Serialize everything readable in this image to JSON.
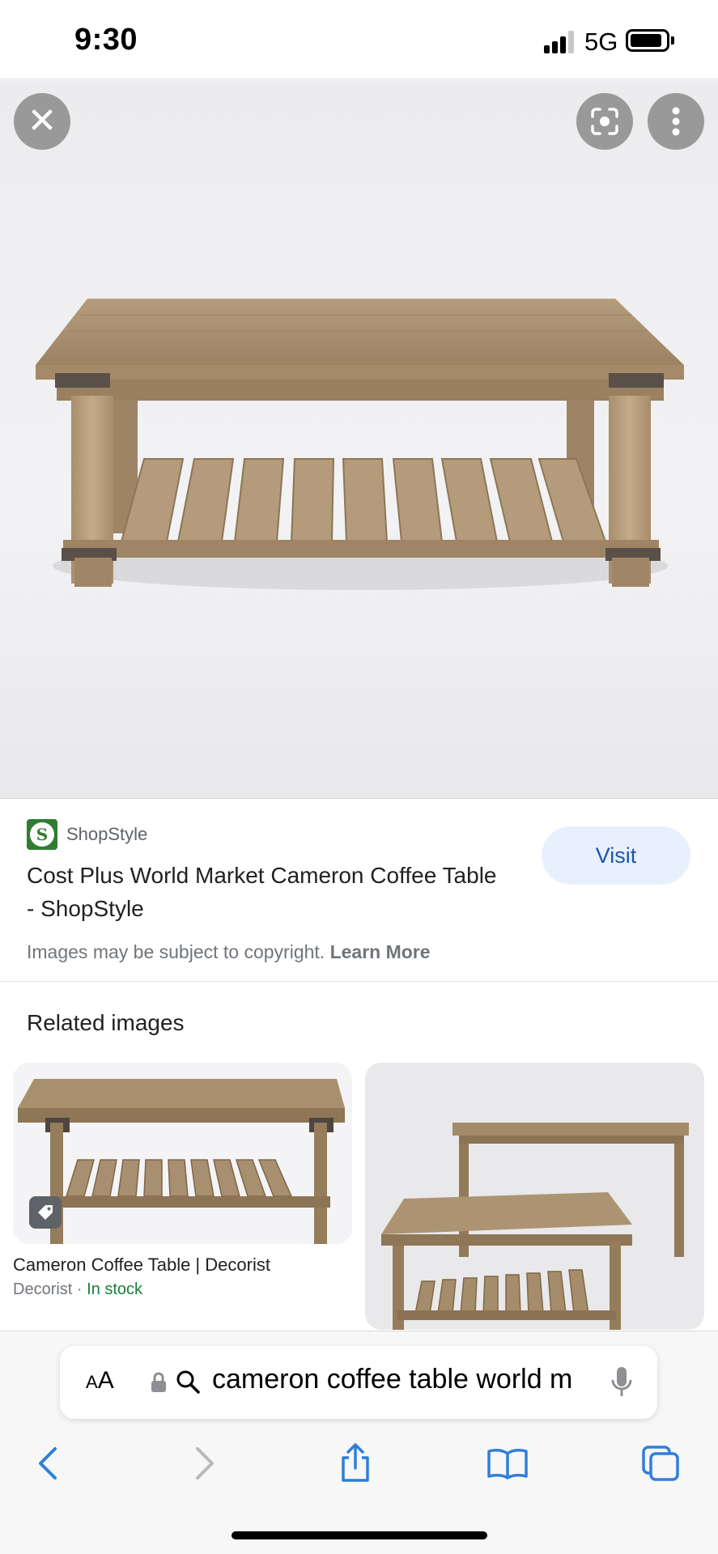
{
  "status_bar": {
    "time": "9:30",
    "network": "5G",
    "icons": [
      "signal-icon",
      "battery-icon"
    ]
  },
  "hero": {
    "icons": [
      "close-icon",
      "lens-icon",
      "more-vert-icon"
    ],
    "image_description_name": "coffee-table-image"
  },
  "result": {
    "source": "ShopStyle",
    "source_logo_letter": "S",
    "title": "Cost Plus World Market Cameron Coffee Table - ShopStyle",
    "visit_label": "Visit",
    "copyright_text": "Images may be subject to copyright.",
    "learn_more": "Learn More"
  },
  "related": {
    "heading": "Related images",
    "items": [
      {
        "title": "Cameron Coffee Table | Decorist",
        "source": "Decorist",
        "separator": " · ",
        "availability": "In stock",
        "icon": "tag-icon"
      },
      {
        "title": "",
        "source": ""
      }
    ]
  },
  "browser": {
    "text_size_label_small": "A",
    "text_size_label_large": "A",
    "url_text": "cameron coffee table world m",
    "icons": [
      "lock-icon",
      "search-icon",
      "mic-icon",
      "back-icon",
      "forward-icon",
      "share-icon",
      "bookmarks-icon",
      "tabs-icon"
    ]
  },
  "colors": {
    "accent_blue": "#1a56b0",
    "visit_bg": "#e8f0fe",
    "in_stock_green": "#188038",
    "safari_blue": "#2f7fd8"
  }
}
